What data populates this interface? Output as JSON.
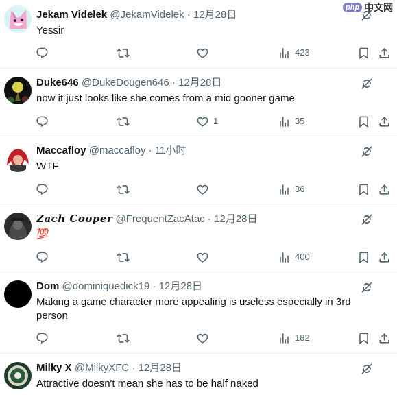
{
  "tweets": [
    {
      "name": "Jekam Videlek",
      "handle": "@JekamVidelek",
      "date": "12月28日",
      "text": "Yessir",
      "replies": "",
      "retweets": "",
      "likes": "",
      "views": "423"
    },
    {
      "name": "Duke646",
      "handle": "@DukeDougen646",
      "date": "12月28日",
      "text": "now it just looks like she comes from a mid gooner game",
      "replies": "",
      "retweets": "",
      "likes": "1",
      "views": "35"
    },
    {
      "name": "Maccafloy",
      "handle": "@maccafloy",
      "date": "11小时",
      "text": "WTF",
      "replies": "",
      "retweets": "",
      "likes": "",
      "views": "36"
    },
    {
      "name": "Zach Cooper",
      "handle": "@FrequentZacAtac",
      "date": "12月28日",
      "text": "💯",
      "replies": "",
      "retweets": "",
      "likes": "",
      "views": "400"
    },
    {
      "name": "Dom",
      "handle": "@dominiquedick19",
      "date": "12月28日",
      "text": "Making a game character more appealing is useless especially in 3rd person",
      "replies": "",
      "retweets": "",
      "likes": "",
      "views": "182"
    },
    {
      "name": "Milky X",
      "handle": "@MilkyXFC",
      "date": "12月28日",
      "text": "Attractive doesn't mean she has to be half naked"
    }
  ],
  "separator": "·",
  "icons": {
    "reply": "reply-icon",
    "retweet": "retweet-icon",
    "like": "heart-icon",
    "views": "views-icon",
    "bookmark": "bookmark-icon",
    "share": "share-icon",
    "grok": "grok-icon",
    "more": "more-icon"
  },
  "colors": {
    "text": "#0f1419",
    "muted": "#536471",
    "divider": "#eff3f4"
  },
  "watermark": {
    "badge": "php",
    "text": "中文网"
  }
}
